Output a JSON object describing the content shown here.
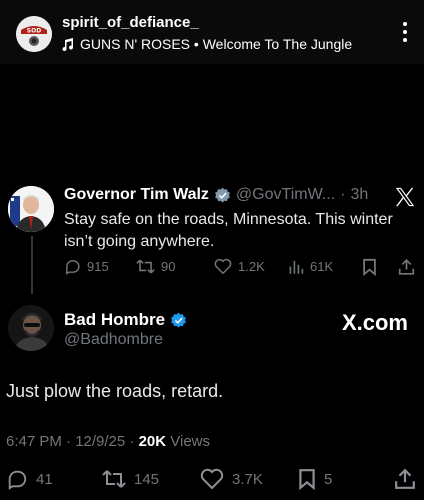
{
  "story": {
    "username": "spirit_of_defiance_",
    "song": "GUNS N' ROSES • Welcome To The Jungle",
    "music_icon": "music-note-icon",
    "avatar_text": "SOD"
  },
  "quoted_tweet": {
    "name": "Governor Tim Walz",
    "handle": "@GovTimW...",
    "separator": "·",
    "time": "3h",
    "text": "Stay safe on the roads, Minnesota. This winter isn’t going anywhere.",
    "replies": "915",
    "reposts": "90",
    "likes": "1.2K",
    "views": "61K"
  },
  "main_tweet": {
    "name": "Bad Hombre",
    "handle": "@Badhombre",
    "watermark": "X.com",
    "text": "Just plow the roads, retard.",
    "timestamp": "6:47 PM · 12/9/25 · ",
    "views_count": "20K",
    "views_label": " Views",
    "replies": "41",
    "reposts": "145",
    "likes": "3.7K",
    "bookmarks": "5"
  },
  "colors": {
    "background": "#000000",
    "text_primary": "#e7e9ea",
    "text_secondary": "#71767b",
    "verified_blue": "#1d9bf0"
  }
}
